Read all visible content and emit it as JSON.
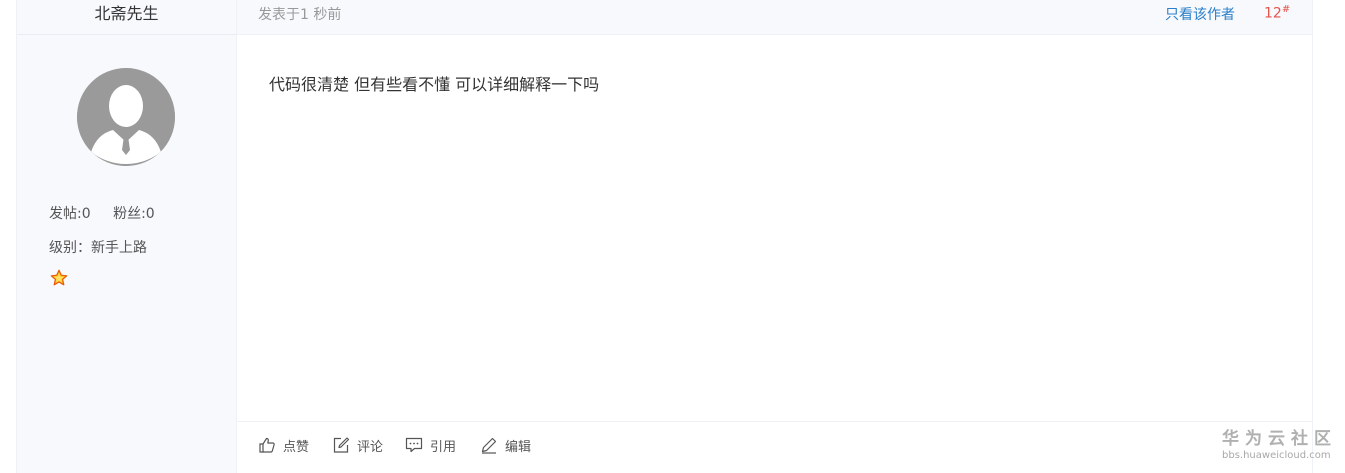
{
  "author": {
    "name": "北斋先生",
    "posts_label": "发帖:0",
    "fans_label": "粉丝:0",
    "level_label": "级别：新手上路",
    "level_icon": "star-badge-icon"
  },
  "header": {
    "post_time": "发表于1 秒前",
    "only_author": "只看该作者",
    "floor_number": "12",
    "floor_mark": "#"
  },
  "content": {
    "text": "代码很清楚 但有些看不懂 可以详细解释一下吗"
  },
  "actions": [
    {
      "label": "点赞",
      "icon": "thumbs-up-icon"
    },
    {
      "label": "评论",
      "icon": "edit-square-icon"
    },
    {
      "label": "引用",
      "icon": "quote-bubble-icon"
    },
    {
      "label": "编辑",
      "icon": "pencil-icon"
    }
  ],
  "watermark": {
    "title": "华为云社区",
    "url": "bbs.huaweicloud.com"
  },
  "colors": {
    "sidebar_bg": "#f7f9fd",
    "link": "#2a7fc9",
    "floor": "#e5534b",
    "avatar": "#9a9a9a"
  }
}
